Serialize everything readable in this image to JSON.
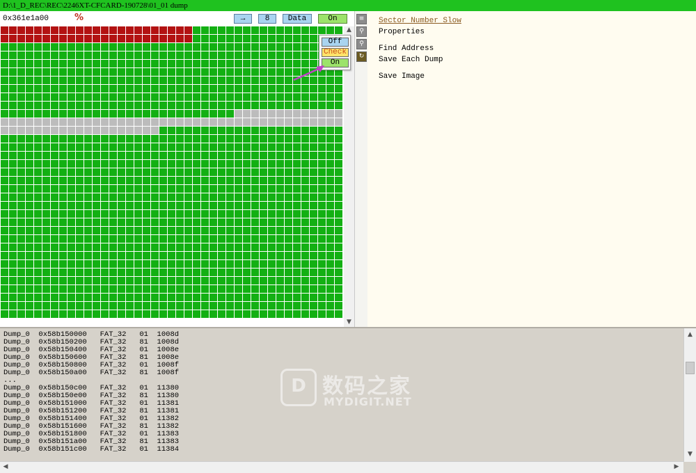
{
  "window": {
    "title": "D:\\1_D_REC\\REC\\2246XT-CFCARD-190728\\01_01 dump"
  },
  "toolbar": {
    "address_value": "0x361e1a00",
    "percent_glyph": "%",
    "arrow_button": "→",
    "count_button": "8",
    "data_button": "Data",
    "mode_button": "On"
  },
  "mode_menu": {
    "items": [
      "Off",
      "Check",
      "On"
    ]
  },
  "sector_map": {
    "columns": 41,
    "rows": 35,
    "colors": {
      "good": "#13b013",
      "bad": "#b31212",
      "unread": "#bcbcbc"
    },
    "runs": [
      {
        "status": "bad",
        "count": 23
      },
      {
        "status": "good",
        "count": 18
      },
      {
        "status": "bad",
        "count": 23
      },
      {
        "status": "good",
        "count": 374
      },
      {
        "status": "unread",
        "count": 73
      },
      {
        "status": "good",
        "count": 924
      }
    ]
  },
  "side_icons": [
    "list-icon",
    "pin-icon",
    "pin-alt-icon",
    "refresh-icon"
  ],
  "right_menu": {
    "sector_number_slow": "Sector Number Slow",
    "properties": "Properties",
    "find_address": "Find Address",
    "save_each_dump": "Save Each Dump",
    "save_image": "Save Image"
  },
  "log": {
    "lines": [
      "Dump_0  0x58b150000   FAT_32   01  1008d",
      "Dump_0  0x58b150200   FAT_32   81  1008d",
      "Dump_0  0x58b150400   FAT_32   01  1008e",
      "Dump_0  0x58b150600   FAT_32   81  1008e",
      "Dump_0  0x58b150800   FAT_32   01  1008f",
      "Dump_0  0x58b150a00   FAT_32   81  1008f",
      "...",
      "Dump_0  0x58b150c00   FAT_32   01  11380",
      "Dump_0  0x58b150e00   FAT_32   81  11380",
      "Dump_0  0x58b151000   FAT_32   01  11381",
      "Dump_0  0x58b151200   FAT_32   81  11381",
      "Dump_0  0x58b151400   FAT_32   01  11382",
      "Dump_0  0x58b151600   FAT_32   81  11382",
      "Dump_0  0x58b151800   FAT_32   01  11383",
      "Dump_0  0x58b151a00   FAT_32   81  11383",
      "Dump_0  0x58b151c00   FAT_32   01  11384"
    ]
  },
  "watermark": {
    "logo_letter": "D",
    "cn_text": "数码之家",
    "en_text": "MYDIGIT.NET"
  }
}
